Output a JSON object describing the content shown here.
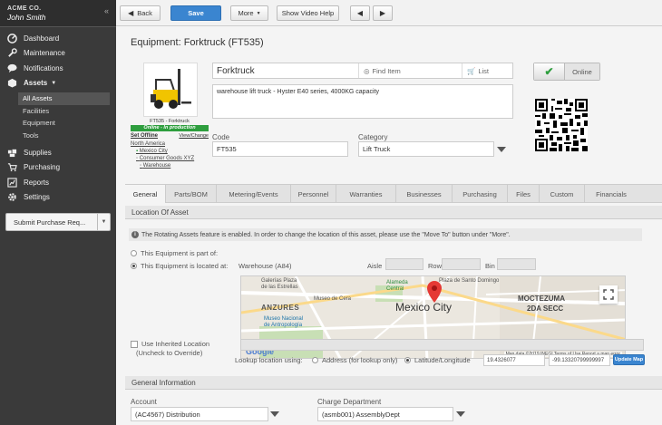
{
  "sidebar": {
    "company": "ACME CO.",
    "user": "John Smith",
    "collapse_icon": "chevron-double-left-icon",
    "items": [
      {
        "label": "Dashboard",
        "icon": "dashboard-icon"
      },
      {
        "label": "Maintenance",
        "icon": "wrench-icon"
      },
      {
        "label": "Notifications",
        "icon": "chat-bubble-icon"
      },
      {
        "label": "Assets",
        "icon": "box-icon"
      },
      {
        "label": "Supplies",
        "icon": "supplies-icon"
      },
      {
        "label": "Purchasing",
        "icon": "cart-icon"
      },
      {
        "label": "Reports",
        "icon": "chart-icon"
      },
      {
        "label": "Settings",
        "icon": "gear-icon"
      }
    ],
    "asset_subitems": [
      "All Assets",
      "Facilities",
      "Equipment",
      "Tools"
    ],
    "submit_label": "Submit Purchase Req..."
  },
  "toolbar": {
    "back_label": "Back",
    "save_label": "Save",
    "more_label": "More",
    "video_label": "Show Video Help"
  },
  "equipment": {
    "title": "Equipment: Forktruck (FT535)",
    "photo_caption": "FT535 - Forktruck",
    "status": "Online - In production",
    "set_offline": "Set Offline",
    "view_change": "View/Change",
    "location_tree": [
      "North America",
      "Mexico City",
      "Consumer Goods XYZ",
      "Warehouse"
    ],
    "name": "Forktruck",
    "find_item": "Find Item",
    "list": "List",
    "description": "warehouse lift truck - Hyster E40 series, 4000KG capacity",
    "online_label": "Online",
    "code_label": "Code",
    "code_value": "FT535",
    "category_label": "Category",
    "category_value": "Lift Truck"
  },
  "tabs": [
    "General",
    "Parts/BOM",
    "Metering/Events",
    "Personnel",
    "Warranties",
    "Businesses",
    "Purchasing",
    "Files",
    "Custom",
    "Financials"
  ],
  "location": {
    "section_title": "Location Of Asset",
    "info": "The Rotating Assets feature is enabled. In order to change the location of this asset, please use the \"Move To\" button under \"More\".",
    "part_of_label": "This Equipment is part of:",
    "located_at_label": "This Equipment is located at:",
    "located_value": "Warehouse (A84)",
    "aisle_label": "Aisle",
    "row_label": "Row",
    "bin_label": "Bin",
    "use_inherited_label": "Use Inherited Location",
    "uncheck_hint": "(Uncheck to Override)",
    "lookup_label": "Lookup location using:",
    "address_option": "Address (for lookup only)",
    "latlng_option": "Latitude/Longitude",
    "latitude": "19.4326077",
    "longitude": "-99.13320799999997",
    "update_map_label": "Update Map"
  },
  "map": {
    "city_label": "Mexico City",
    "labels": {
      "galerias": "Galerías Plaza",
      "galerias2": "de las Estrellas",
      "alameda": "Alameda",
      "alameda2": "Central",
      "plaza": "Plaza de Santo Domingo",
      "museo_cera": "Museo de Cera",
      "anzures": "ANZURES",
      "museo_nac": "Museo Nacional",
      "museo_nac2": "de Antropología",
      "moctezuma": "MOCTEZUMA",
      "moctezuma2": "2DA SECC",
      "google": "Google"
    },
    "footer": "Map data ©2019 INEGI   Terms of Use   Report a map error",
    "fullscreen_icon": "fullscreen-icon"
  },
  "general_info": {
    "section_title": "General Information",
    "account_label": "Account",
    "account_value": "(AC4567) Distribution",
    "charge_label": "Charge Department",
    "charge_value": "(asmb001) AssemblyDept"
  }
}
